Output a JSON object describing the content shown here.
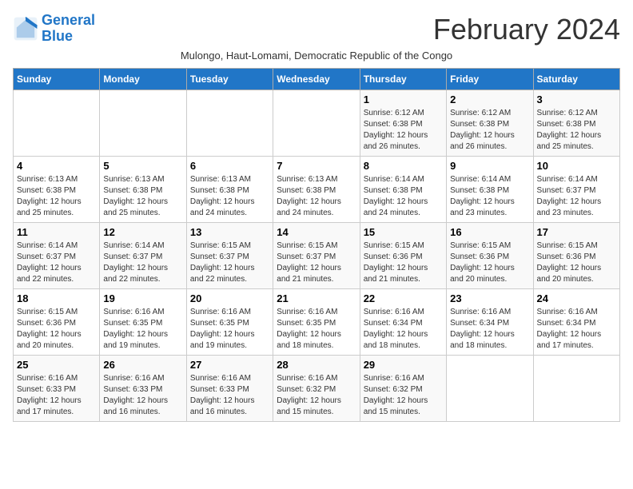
{
  "logo": {
    "line1": "General",
    "line2": "Blue"
  },
  "title": "February 2024",
  "location": "Mulongo, Haut-Lomami, Democratic Republic of the Congo",
  "days_of_week": [
    "Sunday",
    "Monday",
    "Tuesday",
    "Wednesday",
    "Thursday",
    "Friday",
    "Saturday"
  ],
  "weeks": [
    [
      {
        "day": "",
        "info": ""
      },
      {
        "day": "",
        "info": ""
      },
      {
        "day": "",
        "info": ""
      },
      {
        "day": "",
        "info": ""
      },
      {
        "day": "1",
        "info": "Sunrise: 6:12 AM\nSunset: 6:38 PM\nDaylight: 12 hours and 26 minutes."
      },
      {
        "day": "2",
        "info": "Sunrise: 6:12 AM\nSunset: 6:38 PM\nDaylight: 12 hours and 26 minutes."
      },
      {
        "day": "3",
        "info": "Sunrise: 6:12 AM\nSunset: 6:38 PM\nDaylight: 12 hours and 25 minutes."
      }
    ],
    [
      {
        "day": "4",
        "info": "Sunrise: 6:13 AM\nSunset: 6:38 PM\nDaylight: 12 hours and 25 minutes."
      },
      {
        "day": "5",
        "info": "Sunrise: 6:13 AM\nSunset: 6:38 PM\nDaylight: 12 hours and 25 minutes."
      },
      {
        "day": "6",
        "info": "Sunrise: 6:13 AM\nSunset: 6:38 PM\nDaylight: 12 hours and 24 minutes."
      },
      {
        "day": "7",
        "info": "Sunrise: 6:13 AM\nSunset: 6:38 PM\nDaylight: 12 hours and 24 minutes."
      },
      {
        "day": "8",
        "info": "Sunrise: 6:14 AM\nSunset: 6:38 PM\nDaylight: 12 hours and 24 minutes."
      },
      {
        "day": "9",
        "info": "Sunrise: 6:14 AM\nSunset: 6:38 PM\nDaylight: 12 hours and 23 minutes."
      },
      {
        "day": "10",
        "info": "Sunrise: 6:14 AM\nSunset: 6:37 PM\nDaylight: 12 hours and 23 minutes."
      }
    ],
    [
      {
        "day": "11",
        "info": "Sunrise: 6:14 AM\nSunset: 6:37 PM\nDaylight: 12 hours and 22 minutes."
      },
      {
        "day": "12",
        "info": "Sunrise: 6:14 AM\nSunset: 6:37 PM\nDaylight: 12 hours and 22 minutes."
      },
      {
        "day": "13",
        "info": "Sunrise: 6:15 AM\nSunset: 6:37 PM\nDaylight: 12 hours and 22 minutes."
      },
      {
        "day": "14",
        "info": "Sunrise: 6:15 AM\nSunset: 6:37 PM\nDaylight: 12 hours and 21 minutes."
      },
      {
        "day": "15",
        "info": "Sunrise: 6:15 AM\nSunset: 6:36 PM\nDaylight: 12 hours and 21 minutes."
      },
      {
        "day": "16",
        "info": "Sunrise: 6:15 AM\nSunset: 6:36 PM\nDaylight: 12 hours and 20 minutes."
      },
      {
        "day": "17",
        "info": "Sunrise: 6:15 AM\nSunset: 6:36 PM\nDaylight: 12 hours and 20 minutes."
      }
    ],
    [
      {
        "day": "18",
        "info": "Sunrise: 6:15 AM\nSunset: 6:36 PM\nDaylight: 12 hours and 20 minutes."
      },
      {
        "day": "19",
        "info": "Sunrise: 6:16 AM\nSunset: 6:35 PM\nDaylight: 12 hours and 19 minutes."
      },
      {
        "day": "20",
        "info": "Sunrise: 6:16 AM\nSunset: 6:35 PM\nDaylight: 12 hours and 19 minutes."
      },
      {
        "day": "21",
        "info": "Sunrise: 6:16 AM\nSunset: 6:35 PM\nDaylight: 12 hours and 18 minutes."
      },
      {
        "day": "22",
        "info": "Sunrise: 6:16 AM\nSunset: 6:34 PM\nDaylight: 12 hours and 18 minutes."
      },
      {
        "day": "23",
        "info": "Sunrise: 6:16 AM\nSunset: 6:34 PM\nDaylight: 12 hours and 18 minutes."
      },
      {
        "day": "24",
        "info": "Sunrise: 6:16 AM\nSunset: 6:34 PM\nDaylight: 12 hours and 17 minutes."
      }
    ],
    [
      {
        "day": "25",
        "info": "Sunrise: 6:16 AM\nSunset: 6:33 PM\nDaylight: 12 hours and 17 minutes."
      },
      {
        "day": "26",
        "info": "Sunrise: 6:16 AM\nSunset: 6:33 PM\nDaylight: 12 hours and 16 minutes."
      },
      {
        "day": "27",
        "info": "Sunrise: 6:16 AM\nSunset: 6:33 PM\nDaylight: 12 hours and 16 minutes."
      },
      {
        "day": "28",
        "info": "Sunrise: 6:16 AM\nSunset: 6:32 PM\nDaylight: 12 hours and 15 minutes."
      },
      {
        "day": "29",
        "info": "Sunrise: 6:16 AM\nSunset: 6:32 PM\nDaylight: 12 hours and 15 minutes."
      },
      {
        "day": "",
        "info": ""
      },
      {
        "day": "",
        "info": ""
      }
    ]
  ]
}
